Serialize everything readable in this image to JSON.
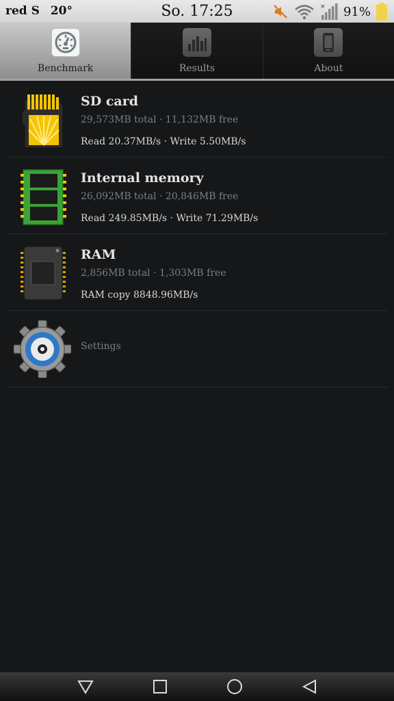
{
  "statusbar": {
    "carrier": "red S",
    "temperature": "20°",
    "time": "So. 17:25",
    "battery_percent": "91%",
    "icons": [
      "muted-speaker-icon",
      "wifi-icon",
      "signal-icon",
      "battery-icon"
    ]
  },
  "tabs": [
    {
      "label": "Benchmark",
      "icon": "speedometer-icon",
      "active": true
    },
    {
      "label": "Results",
      "icon": "bar-chart-icon",
      "active": false
    },
    {
      "label": "About",
      "icon": "phone-icon",
      "active": false
    }
  ],
  "items": [
    {
      "title": "SD card",
      "subtitle": "29,573MB total · 11,132MB free",
      "stats": "Read 20.37MB/s · Write 5.50MB/s",
      "icon": "sd-card-icon"
    },
    {
      "title": "Internal memory",
      "subtitle": "26,092MB total · 20,846MB free",
      "stats": "Read 249.85MB/s · Write 71.29MB/s",
      "icon": "memory-chip-icon"
    },
    {
      "title": "RAM",
      "subtitle": "2,856MB total · 1,303MB free",
      "stats": "RAM copy 8848.96MB/s",
      "icon": "ram-chip-icon"
    }
  ],
  "settings": {
    "label": "Settings",
    "icon": "gear-icon"
  },
  "navbar": {
    "buttons": [
      "notifications-down-icon",
      "recent-apps-icon",
      "home-icon",
      "back-icon"
    ]
  },
  "colors": {
    "accent_yellow": "#f4c400",
    "memory_green": "#3aa335",
    "gear_blue": "#2f78c8",
    "battery_yellow": "#f2d24a"
  }
}
